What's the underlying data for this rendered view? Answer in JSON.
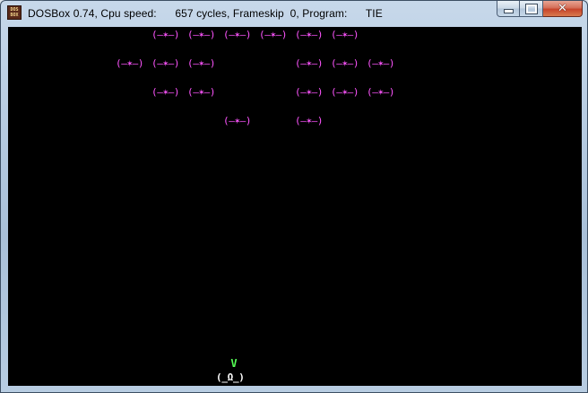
{
  "window": {
    "title": "DOSBox 0.74, Cpu speed:      657 cycles, Frameskip  0, Program:      TIE",
    "icon_text": "DOS BOX",
    "buttons": {
      "minimize": "minimize-icon",
      "maximize": "maximize-icon",
      "close": "close-icon"
    }
  },
  "game": {
    "enemy_sprite": "(–✶–)",
    "enemy_color": "#ff55ff",
    "formation": [
      [
        "(–✶–)",
        "(–✶–)",
        "(–✶–)",
        "(–✶–)",
        "(–✶–)",
        "(–✶–)"
      ],
      [
        "(–✶–)",
        "(–✶–)",
        "(–✶–)",
        "(–✶–)",
        "(–✶–)",
        "(–✶–)"
      ],
      [
        "(–✶–)",
        "(–✶–)",
        "(–✶–)",
        "(–✶–)",
        "(–✶–)"
      ],
      [
        "(–✶–)",
        "(–✶–)"
      ]
    ],
    "player": {
      "gun": "V",
      "ship": "(_Ω_)",
      "gun_color": "#55ff55",
      "ship_color": "#ffffff"
    },
    "background": "#000000"
  }
}
